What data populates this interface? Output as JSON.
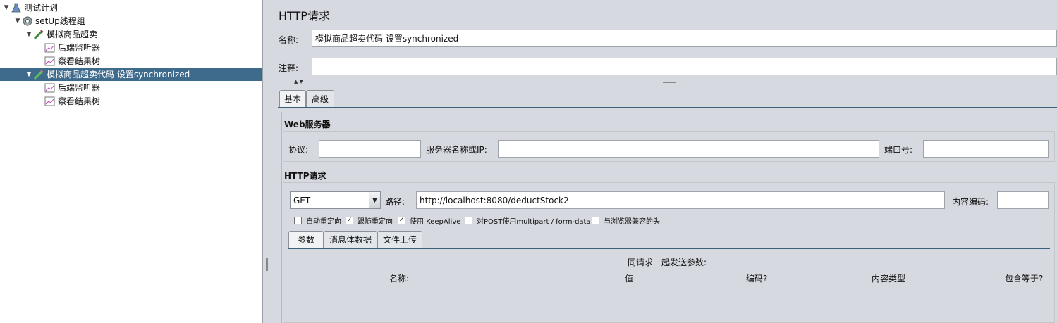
{
  "tree": {
    "items": [
      {
        "label": "测试计划",
        "icon": "test-plan-icon"
      },
      {
        "label": "setUp线程组",
        "icon": "gear-icon"
      },
      {
        "label": "模拟商品超卖",
        "icon": "sampler-icon"
      },
      {
        "label": "后端监听器",
        "icon": "listener-chart-icon"
      },
      {
        "label": "察看结果树",
        "icon": "listener-chart-icon"
      },
      {
        "label": "模拟商品超卖代码 设置synchronized",
        "icon": "sampler-icon"
      },
      {
        "label": "后端监听器",
        "icon": "listener-chart-icon"
      },
      {
        "label": "察看结果树",
        "icon": "listener-chart-icon"
      }
    ]
  },
  "panel": {
    "title": "HTTP请求",
    "name_label": "名称:",
    "name_value": "模拟商品超卖代码 设置synchronized",
    "comment_label": "注释:",
    "comment_value": ""
  },
  "tabs": {
    "basic": "基本",
    "advanced": "高级"
  },
  "web_server": {
    "heading": "Web服务器",
    "protocol_label": "协议:",
    "protocol_value": "",
    "server_label": "服务器名称或IP:",
    "server_value": "",
    "port_label": "端口号:",
    "port_value": ""
  },
  "http_request": {
    "heading": "HTTP请求",
    "method": "GET",
    "path_label": "路径:",
    "path_value": "http://localhost:8080/deductStock2",
    "encoding_label": "内容编码:",
    "encoding_value": ""
  },
  "options": [
    {
      "label": "自动重定向",
      "checked": false
    },
    {
      "label": "跟随重定向",
      "checked": true
    },
    {
      "label": "使用 KeepAlive",
      "checked": true
    },
    {
      "label": "对POST使用multipart / form-data",
      "checked": false
    },
    {
      "label": "与浏览器兼容的头",
      "checked": false
    }
  ],
  "sub_tabs": {
    "params": "参数",
    "body": "消息体数据",
    "files": "文件上传"
  },
  "params_table": {
    "caption": "同请求一起发送参数:",
    "columns": [
      "名称:",
      "值",
      "编码?",
      "内容类型",
      "包含等于?"
    ]
  },
  "colors": {
    "selection": "#3e6a8c",
    "panel_bg": "#d6d9df"
  }
}
